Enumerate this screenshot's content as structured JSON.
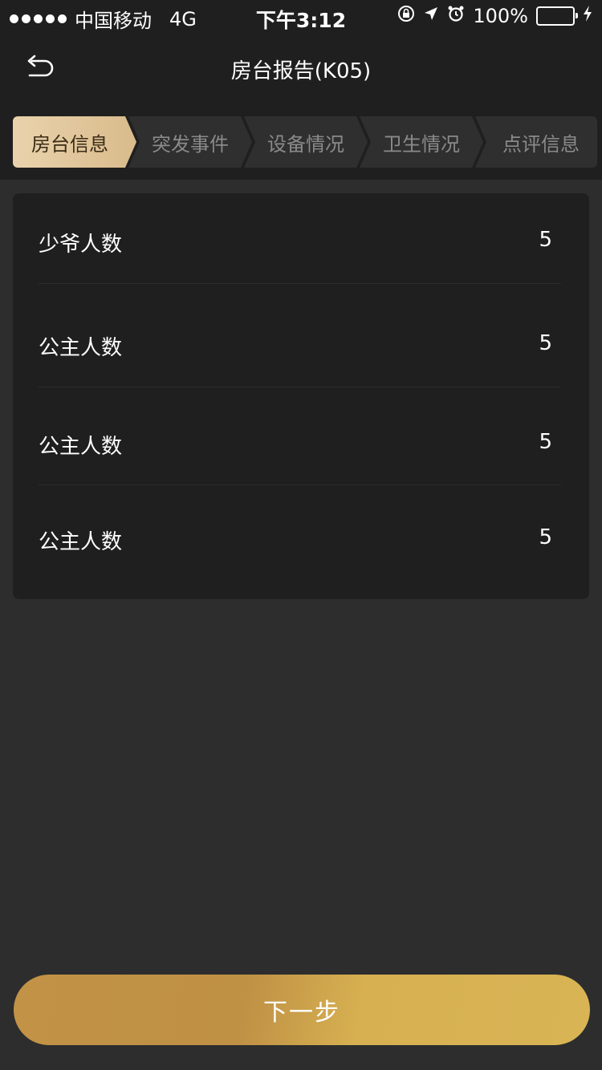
{
  "status_bar": {
    "carrier": "中国移动",
    "network": "4G",
    "time": "下午3:12",
    "battery": "100%",
    "battery_level": 1.0,
    "battery_color": "#4cd964",
    "icons": [
      "rotation-lock-icon",
      "location-icon",
      "alarm-icon",
      "charging-icon"
    ]
  },
  "nav": {
    "title": "房台报告(K05)",
    "back_icon": "back-arrow-icon"
  },
  "steps": [
    {
      "label": "房台信息",
      "active": true
    },
    {
      "label": "突发事件",
      "active": false
    },
    {
      "label": "设备情况",
      "active": false
    },
    {
      "label": "卫生情况",
      "active": false
    },
    {
      "label": "点评信息",
      "active": false
    }
  ],
  "rows": [
    {
      "label": "少爷人数",
      "value": "5"
    },
    {
      "label": "公主人数",
      "value": "5"
    },
    {
      "label": "公主人数",
      "value": "5"
    },
    {
      "label": "公主人数",
      "value": "5"
    }
  ],
  "next_button": {
    "label": "下一步"
  },
  "colors": {
    "background": "#2d2d2d",
    "card": "#1f1f1f",
    "accent_gold": "#d7b051",
    "active_tab": "#e9d2ac"
  }
}
